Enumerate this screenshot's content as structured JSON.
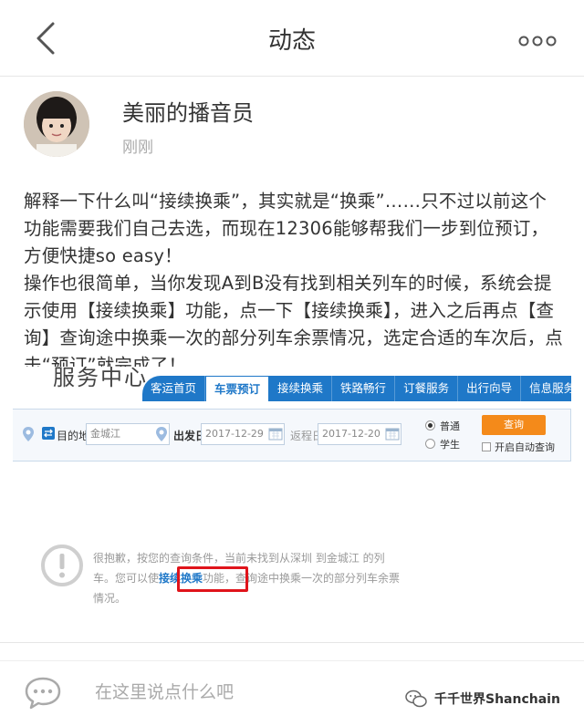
{
  "header": {
    "title": "动态"
  },
  "author": {
    "name": "美丽的播音员",
    "time": "刚刚"
  },
  "post": {
    "paragraphs": [
      "解释一下什么叫“接续换乘”，其实就是“换乘”……只不过以前这个功能需要我们自己去选，而现在12306能够帮我们一步到位预订，方便快捷so easy！",
      "操作也很简单，当你发现A到B没有找到相关列车的时候，系统会提示使用【接续换乘】功能，点一下【接续换乘】，进入之后再点【查询】查询途中换乘一次的部分列车余票情况，选定合适的车次后，点击“预订”就完成了！"
    ]
  },
  "embed": {
    "logo": "服务中心",
    "nav": [
      "客运首页",
      "车票预订",
      "接续换乘",
      "铁路畅行",
      "订餐服务",
      "出行向导",
      "信息服务"
    ],
    "active_nav": "车票预订",
    "search": {
      "destination_label": "目的地",
      "destination_value": "金城江",
      "depart_label": "出发日",
      "depart_value": "2017-12-29",
      "return_label": "返程日",
      "return_value": "2017-12-20",
      "ticket_types": [
        "普通",
        "学生"
      ],
      "selected_type": "普通",
      "query_button": "查询",
      "auto_query_label": "开启自动查询"
    },
    "notice": {
      "text_before": "很抱歉，按您的查询条件，当前未找到从深圳 到金城江 的列车。您可以使",
      "link": "接续换乘",
      "text_after": "功能，查询途中换乘一次的部分列车余票情况。"
    },
    "colors": {
      "nav_blue": "#1f78c8",
      "query_orange": "#f48a1a",
      "highlight_red": "#e0141b"
    }
  },
  "comment": {
    "placeholder": "在这里说点什么吧"
  },
  "watermark": {
    "text": "千千世界Shanchain"
  }
}
